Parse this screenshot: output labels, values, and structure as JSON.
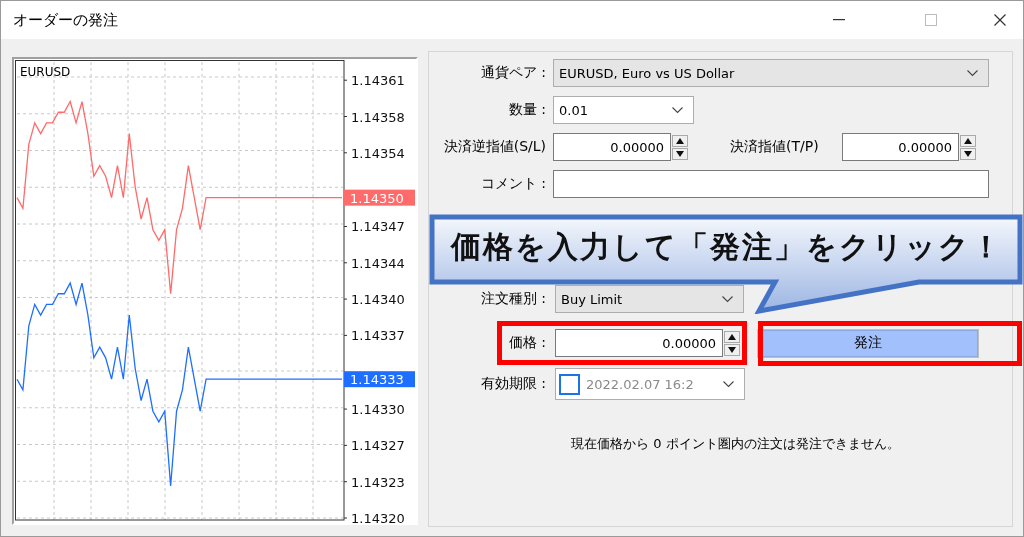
{
  "window": {
    "title": "オーダーの発注"
  },
  "chart": {
    "symbol": "EURUSD",
    "price_labels": [
      {
        "text": "1.14350"
      },
      {
        "text": "1.14333"
      }
    ],
    "chart_data": {
      "type": "line",
      "grid": true,
      "ylim": [
        1.1432,
        1.143613
      ],
      "yticks": [
        {
          "value": 1.14361,
          "label": "1.14361"
        },
        {
          "value": 1.143576,
          "label": "1.14358"
        },
        {
          "value": 1.143542,
          "label": "1.14354"
        },
        {
          "value": 1.143473,
          "label": "1.14347"
        },
        {
          "value": 1.143439,
          "label": "1.14344"
        },
        {
          "value": 1.143405,
          "label": "1.14340"
        },
        {
          "value": 1.143371,
          "label": "1.14337"
        },
        {
          "value": 1.143302,
          "label": "1.14330"
        },
        {
          "value": 1.143268,
          "label": "1.14327"
        },
        {
          "value": 1.143234,
          "label": "1.14323"
        },
        {
          "value": 1.1432,
          "label": "1.14320"
        }
      ],
      "categories": [
        null,
        null,
        null,
        null,
        null,
        null,
        null,
        null,
        null,
        null,
        null,
        null,
        null,
        null,
        null,
        null,
        null,
        null,
        null,
        null,
        null,
        null,
        null,
        null,
        null,
        null,
        null,
        null,
        null,
        null,
        null,
        null,
        null,
        null,
        null,
        null,
        null,
        null,
        null,
        null,
        null,
        null,
        null,
        null,
        null,
        null,
        null,
        null,
        null,
        null,
        null,
        null,
        null,
        null,
        null,
        null
      ],
      "series": [
        {
          "color": "#ff6a6a",
          "values": [
            1.1435,
            1.14349,
            1.14355,
            1.14357,
            1.14356,
            1.14357,
            1.14357,
            1.14358,
            1.14358,
            1.14359,
            1.14357,
            1.14359,
            1.14356,
            1.14352,
            1.14353,
            1.14352,
            1.1435,
            1.14353,
            1.1435,
            1.14356,
            1.14351,
            1.14348,
            1.1435,
            1.14347,
            1.14346,
            1.14347,
            1.14341,
            1.14347,
            1.14349,
            1.14353,
            1.1435,
            1.14347,
            1.1435,
            1.1435,
            1.1435,
            1.1435,
            1.1435,
            1.1435,
            1.1435,
            1.1435,
            1.1435,
            1.1435,
            1.1435,
            1.1435,
            1.1435,
            1.1435,
            1.1435,
            1.1435,
            1.1435,
            1.1435,
            1.1435,
            1.1435,
            1.1435,
            1.1435,
            1.1435,
            1.1435
          ]
        },
        {
          "color": "#1e6fff",
          "values": [
            1.14333,
            1.14332,
            1.14338,
            1.1434,
            1.14339,
            1.1434,
            1.1434,
            1.14341,
            1.14341,
            1.14342,
            1.1434,
            1.14342,
            1.14339,
            1.14335,
            1.14336,
            1.14335,
            1.14333,
            1.14336,
            1.14333,
            1.14339,
            1.14334,
            1.14331,
            1.14333,
            1.1433,
            1.14329,
            1.1433,
            1.14323,
            1.1433,
            1.14332,
            1.14336,
            1.14333,
            1.1433,
            1.14333,
            1.14333,
            1.14333,
            1.14333,
            1.14333,
            1.14333,
            1.14333,
            1.14333,
            1.14333,
            1.14333,
            1.14333,
            1.14333,
            1.14333,
            1.14333,
            1.14333,
            1.14333,
            1.14333,
            1.14333,
            1.14333,
            1.14333,
            1.14333,
            1.14333,
            1.14333,
            1.14333
          ]
        }
      ]
    }
  },
  "form": {
    "symbol": {
      "label": "通貨ペア :",
      "value": "EURUSD, Euro vs US Dollar"
    },
    "volume": {
      "label": "数量 :",
      "value": "0.01"
    },
    "stop_loss": {
      "label": "決済逆指値(S/L)",
      "value": "0.00000"
    },
    "take_profit": {
      "label": "決済指値(T/P)",
      "value": "0.00000"
    },
    "comment": {
      "label": "コメント :"
    },
    "order_type": {
      "label": "注文種別 :",
      "value": "Buy Limit"
    },
    "price": {
      "label": "価格 :",
      "value": "0.00000"
    },
    "place_button": "発注",
    "expiration": {
      "label": "有効期限 :",
      "checked": false,
      "value": "2022.02.07 16:2"
    },
    "note": "現在価格から 0 ポイント圏内の注文は発注できません。"
  },
  "callout": {
    "text": "価格を入力して「発注」をクリック！"
  }
}
